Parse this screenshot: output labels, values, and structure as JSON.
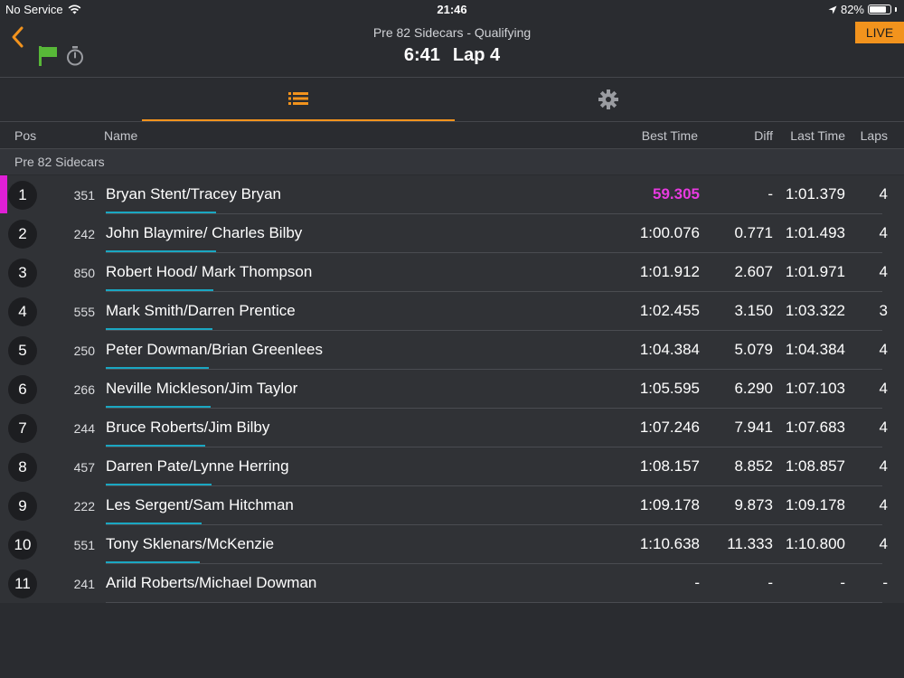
{
  "status_bar": {
    "carrier": "No Service",
    "time": "21:46",
    "battery": "82%",
    "battery_level": 0.82
  },
  "header": {
    "session": "Pre 82 Sidecars - Qualifying",
    "clock": "6:41",
    "lap": "Lap 4",
    "live_label": "LIVE",
    "flag_color": "#58b838",
    "accent": "#f2931d"
  },
  "tabs": [
    {
      "icon": "list-icon",
      "active": true
    },
    {
      "icon": "gear-icon",
      "active": false
    }
  ],
  "columns": {
    "pos": "Pos",
    "name": "Name",
    "best": "Best Time",
    "diff": "Diff",
    "last": "Last Time",
    "laps": "Laps"
  },
  "group_title": "Pre 82 Sidecars",
  "rows": [
    {
      "pos": "1",
      "num": "351",
      "name": "Bryan Stent/Tracey Bryan",
      "best": "59.305",
      "diff": "-",
      "last": "1:01.379",
      "laps": "4"
    },
    {
      "pos": "2",
      "num": "242",
      "name": "John Blaymire/ Charles Bilby",
      "best": "1:00.076",
      "diff": "0.771",
      "last": "1:01.493",
      "laps": "4"
    },
    {
      "pos": "3",
      "num": "850",
      "name": "Robert Hood/ Mark Thompson",
      "best": "1:01.912",
      "diff": "2.607",
      "last": "1:01.971",
      "laps": "4"
    },
    {
      "pos": "4",
      "num": "555",
      "name": "Mark Smith/Darren Prentice",
      "best": "1:02.455",
      "diff": "3.150",
      "last": "1:03.322",
      "laps": "3"
    },
    {
      "pos": "5",
      "num": "250",
      "name": "Peter Dowman/Brian Greenlees",
      "best": "1:04.384",
      "diff": "5.079",
      "last": "1:04.384",
      "laps": "4"
    },
    {
      "pos": "6",
      "num": "266",
      "name": "Neville Mickleson/Jim Taylor",
      "best": "1:05.595",
      "diff": "6.290",
      "last": "1:07.103",
      "laps": "4"
    },
    {
      "pos": "7",
      "num": "244",
      "name": "Bruce Roberts/Jim Bilby",
      "best": "1:07.246",
      "diff": "7.941",
      "last": "1:07.683",
      "laps": "4"
    },
    {
      "pos": "8",
      "num": "457",
      "name": "Darren Pate/Lynne Herring",
      "best": "1:08.157",
      "diff": "8.852",
      "last": "1:08.857",
      "laps": "4"
    },
    {
      "pos": "9",
      "num": "222",
      "name": "Les Sergent/Sam Hitchman",
      "best": "1:09.178",
      "diff": "9.873",
      "last": "1:09.178",
      "laps": "4"
    },
    {
      "pos": "10",
      "num": "551",
      "name": "Tony Sklenars/McKenzie",
      "best": "1:10.638",
      "diff": "11.333",
      "last": "1:10.800",
      "laps": "4"
    },
    {
      "pos": "11",
      "num": "241",
      "name": "Arild Roberts/Michael Dowman",
      "best": "-",
      "diff": "-",
      "last": "-",
      "laps": "-"
    }
  ],
  "colors": {
    "fastest_lap": "#e83ae0",
    "progress_underline": "#1aa7c2",
    "leader_marker": "#e01fd6"
  }
}
